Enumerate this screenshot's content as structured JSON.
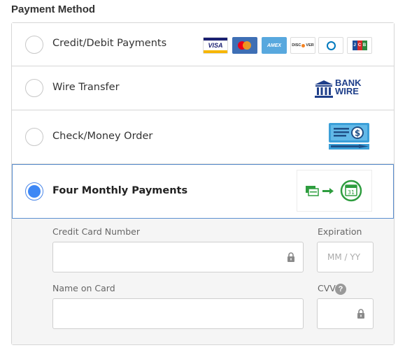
{
  "section_title": "Payment Method",
  "options": [
    {
      "label": "Credit/Debit Payments",
      "selected": false,
      "logos": [
        "VISA",
        "Mastercard",
        "AMEX",
        "DISCOVER",
        "Diners",
        "JCB"
      ]
    },
    {
      "label": "Wire Transfer",
      "selected": false,
      "logo_text": [
        "BANK",
        "WIRE"
      ]
    },
    {
      "label": "Check/Money Order",
      "selected": false
    },
    {
      "label": "Four Monthly Payments",
      "selected": true,
      "calendar_day": "31"
    }
  ],
  "form": {
    "card_number_label": "Credit Card Number",
    "expiration_label": "Expiration",
    "expiration_placeholder": "MM / YY",
    "name_label": "Name on Card",
    "cvv_label": "CVV",
    "cvv_help": "?"
  },
  "colors": {
    "selected_radio": "#3d87f5",
    "selected_border": "#5b8fd0",
    "bank_wire_blue": "#1f3f8a",
    "installment_green": "#2e9d3f"
  },
  "icons": [
    "lock-icon",
    "bank-icon",
    "check-icon",
    "calendar-icon",
    "help-icon"
  ]
}
